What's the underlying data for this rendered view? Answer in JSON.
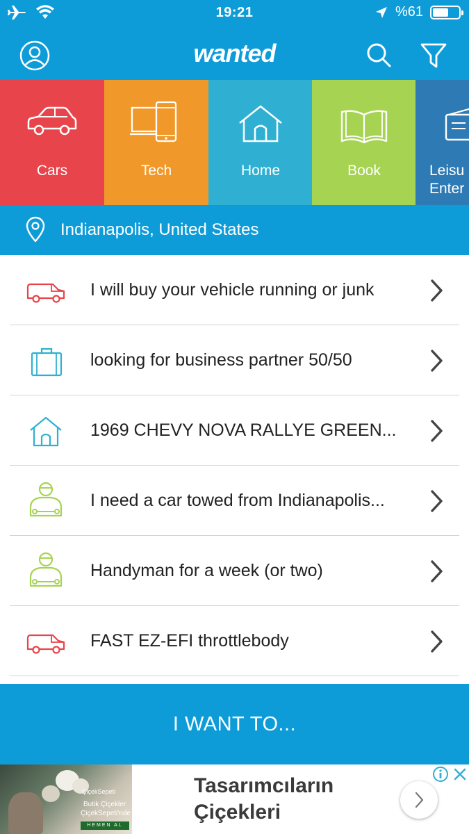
{
  "status_bar": {
    "time": "19:21",
    "battery_text": "%61",
    "battery_level": 0.61
  },
  "nav": {
    "logo": "wanted",
    "icons": [
      "profile-icon",
      "search-icon",
      "filter-icon"
    ]
  },
  "categories": [
    {
      "label": "Cars",
      "icon": "car-icon",
      "color": "#e8444b"
    },
    {
      "label": "Tech",
      "icon": "devices-icon",
      "color": "#f0992a"
    },
    {
      "label": "Home",
      "icon": "house-icon",
      "color": "#2fb0d3"
    },
    {
      "label": "Book",
      "icon": "book-icon",
      "color": "#a6d452"
    },
    {
      "label": "Leisure & Entertainment",
      "label_visible_line1": "Leisu",
      "label_visible_line2": "Enter",
      "icon": "ticket-icon",
      "color": "#2e7ab4"
    }
  ],
  "location": {
    "text": "Indianapolis, United States",
    "icon": "location-pin-icon"
  },
  "listings": [
    {
      "title": "I will buy your vehicle running or junk",
      "icon": "van-icon"
    },
    {
      "title": "looking for business partner 50/50",
      "icon": "briefcase-icon"
    },
    {
      "title": "1969 CHEVY NOVA RALLYE GREEN...",
      "icon": "house-icon"
    },
    {
      "title": "I need a car towed from Indianapolis...",
      "icon": "mechanic-icon"
    },
    {
      "title": "Handyman for a week (or two)",
      "icon": "mechanic-icon"
    },
    {
      "title": "FAST EZ-EFI throttlebody",
      "icon": "van-icon"
    }
  ],
  "cta": {
    "label": "I WANT TO..."
  },
  "ad": {
    "title_line1": "Tasarımcıların",
    "title_line2": "Çiçekleri",
    "image_brand": "ÇiçekSepeti",
    "image_line1": "Butik Çiçekler",
    "image_line2": "ÇiçekSepeti'nde",
    "image_button": "HEMEN AL"
  },
  "colors": {
    "primary": "#0e9cd9",
    "van_icon": "#e8444b",
    "briefcase_icon": "#2fb0d3",
    "mechanic_icon": "#a6d452"
  }
}
